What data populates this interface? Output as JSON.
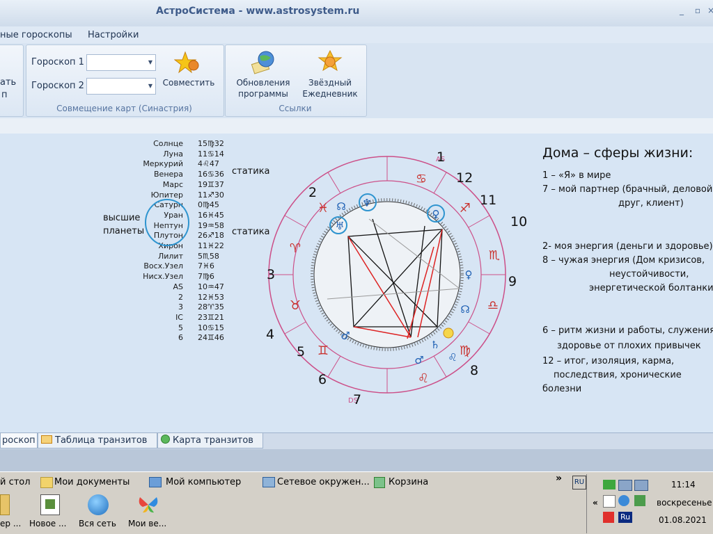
{
  "window": {
    "title": "АстроСистема - www.astrosystem.ru",
    "btn_min": "_",
    "btn_max": "▫",
    "btn_close": "×"
  },
  "menu": {
    "items": [
      "ные гороскопы",
      "Настройки"
    ]
  },
  "ribbon": {
    "left_cut_lines": [
      "ать",
      "п"
    ],
    "synastry": {
      "label1": "Гороскоп 1",
      "label2": "Гороскоп 2",
      "combine": "Совместить",
      "caption": "Совмещение карт (Синастрия)"
    },
    "links": {
      "updates_line1": "Обновления",
      "updates_line2": "программы",
      "diary_line1": "Звёздный",
      "diary_line2": "Ежедневник",
      "caption": "Ссылки"
    }
  },
  "planets": [
    {
      "name": "Солнце",
      "value": "15♍32"
    },
    {
      "name": "Луна",
      "value": "11♋14"
    },
    {
      "name": "Меркурий",
      "value": "4♌47"
    },
    {
      "name": "Венера",
      "value": "16♋36"
    },
    {
      "name": "Марс",
      "value": "19♊37"
    },
    {
      "name": "Юпитер",
      "value": "11♐30"
    },
    {
      "name": "Сатурн",
      "value": "0♍45"
    },
    {
      "name": "Уран",
      "value": "16♓45"
    },
    {
      "name": "Нептун",
      "value": "19♒58"
    },
    {
      "name": "Плутон",
      "value": "26♐18"
    },
    {
      "name": "Хирон",
      "value": "11♓22"
    },
    {
      "name": "Лилит",
      "value": "5♏58"
    },
    {
      "name": "Восх.Узел",
      "value": "7♓6"
    },
    {
      "name": "Нисх.Узел",
      "value": "7♍6"
    },
    {
      "name": "AS",
      "value": "10♒47"
    },
    {
      "name": "2",
      "value": "12♓53"
    },
    {
      "name": "3",
      "value": "28♈35"
    },
    {
      "name": "IC",
      "value": "23♊21"
    },
    {
      "name": "5",
      "value": "10♋15"
    },
    {
      "name": "6",
      "value": "24♊46"
    }
  ],
  "notes": {
    "statika1": "статика",
    "statika2": "статика",
    "higher1": "высшие",
    "higher2": "планеты"
  },
  "houses": [
    "1",
    "2",
    "3",
    "4",
    "5",
    "6",
    "7",
    "8",
    "9",
    "10",
    "11",
    "12"
  ],
  "chart_marks": {
    "as": "AS",
    "ds": "DS"
  },
  "panel": {
    "title": "Дома – сферы жизни:",
    "lines": [
      "1 – «Я» в мире",
      "7 – мой партнер (брачный, деловой,",
      "друг, клиент)",
      "2- моя энергия (деньги и здоровье)",
      "8 – чужая энергия (Дом кризисов,",
      "неустойчивости,",
      "энергетической болтанки)",
      "6 – ритм жизни и работы, служения,",
      "здоровье от  плохих привычек",
      "12 – итог, изоляция, карма,",
      "последствия, хронические",
      "болезни"
    ]
  },
  "tabs": [
    "роскоп",
    "Таблица транзитов",
    "Карта транзитов"
  ],
  "taskbar": {
    "quicklinks": [
      "й стол",
      "Мои документы",
      "Мой компьютер",
      "Сетевое окружен...",
      "Корзина"
    ],
    "chevron": "»",
    "desktop": [
      "ер ...",
      "Новое ...",
      "Вся сеть",
      "Мои ве..."
    ],
    "tray_lang": "Ru",
    "tray_lang2": "RU",
    "tray_chevron": "«",
    "time": "11:14",
    "day": "воскресенье",
    "date": "01.08.2021"
  }
}
